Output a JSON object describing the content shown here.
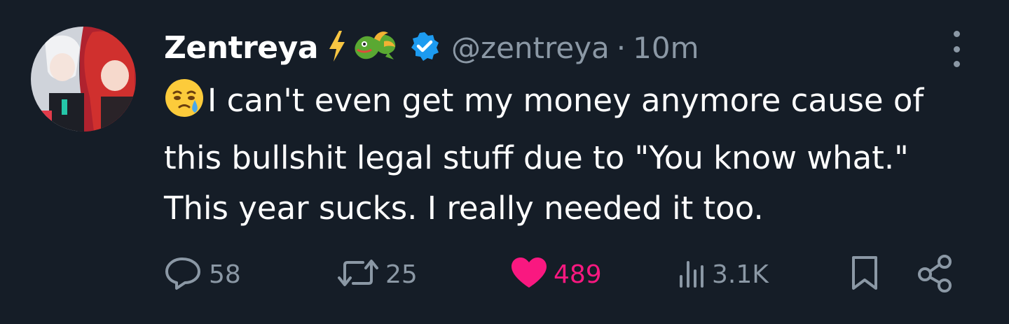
{
  "tweet": {
    "author": {
      "display_name": "Zentreya",
      "badges": [
        "lightning-bolt-emoji",
        "dragon-emoji",
        "verified-badge"
      ],
      "handle": "@zentreya",
      "separator": "·",
      "timestamp": "10m"
    },
    "text_emoji": "face-holding-back-tears-emoji",
    "text": "I can't even get my money anymore cause of this bullshit legal stuff due to \"You know what.\"  This year sucks. I really needed it too.",
    "stats": {
      "replies": "58",
      "retweets": "25",
      "likes": "489",
      "views": "3.1K"
    }
  },
  "colors": {
    "background": "#151d27",
    "text": "#ffffff",
    "muted": "#8b98a5",
    "like": "#f91880",
    "verified": "#1d9bf0"
  },
  "icons": [
    "more-icon",
    "reply-icon",
    "retweet-icon",
    "like-icon",
    "views-icon",
    "bookmark-icon",
    "share-icon"
  ]
}
